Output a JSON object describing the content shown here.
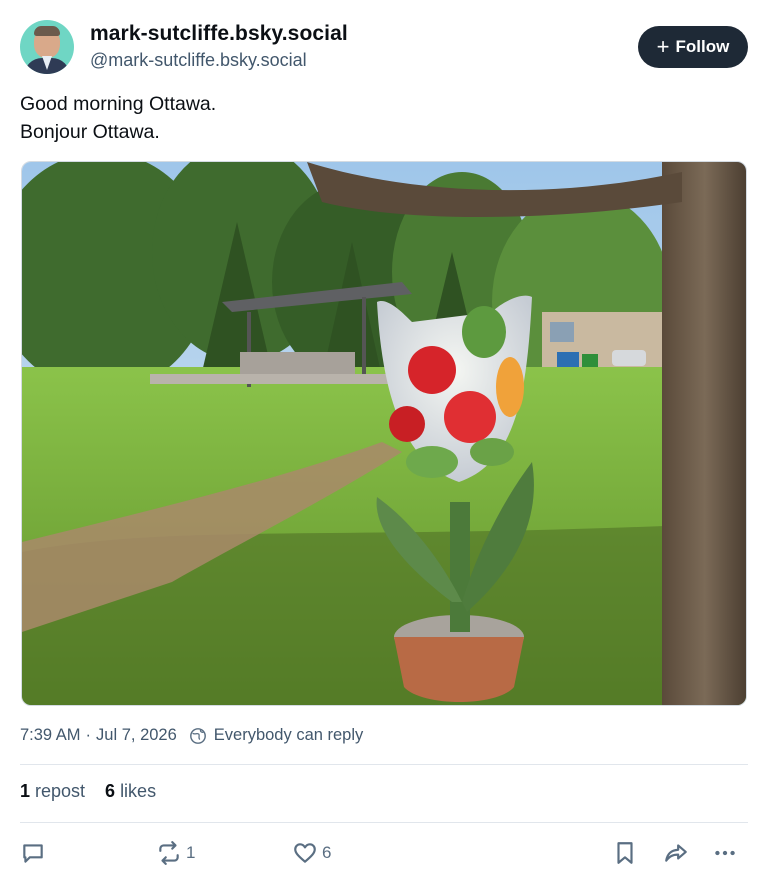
{
  "author": {
    "display_name": "mark-sutcliffe.bsky.social",
    "handle": "@mark-sutcliffe.bsky.social"
  },
  "follow_button": {
    "icon": "plus-icon",
    "label": "Follow"
  },
  "post": {
    "lines": [
      "Good morning Ottawa.",
      "Bonjour Ottawa."
    ]
  },
  "meta": {
    "time": "7:39 AM",
    "separator": "·",
    "date": "Jul 7, 2026",
    "reply_icon": "globe-icon",
    "reply_setting": "Everybody can reply"
  },
  "counts": {
    "reposts": {
      "value": "1",
      "label": "repost"
    },
    "likes": {
      "value": "6",
      "label": "likes"
    }
  },
  "actions": {
    "reply": {
      "icon": "comment-icon"
    },
    "repost": {
      "icon": "repost-icon",
      "count": "1"
    },
    "like": {
      "icon": "heart-icon",
      "count": "6"
    },
    "bookmark": {
      "icon": "bookmark-icon"
    },
    "share": {
      "icon": "share-icon"
    },
    "more": {
      "icon": "more-icon"
    }
  },
  "colors": {
    "follow_bg": "#1e2936",
    "muted_text": "#42576c",
    "icon": "#5a6e82"
  }
}
